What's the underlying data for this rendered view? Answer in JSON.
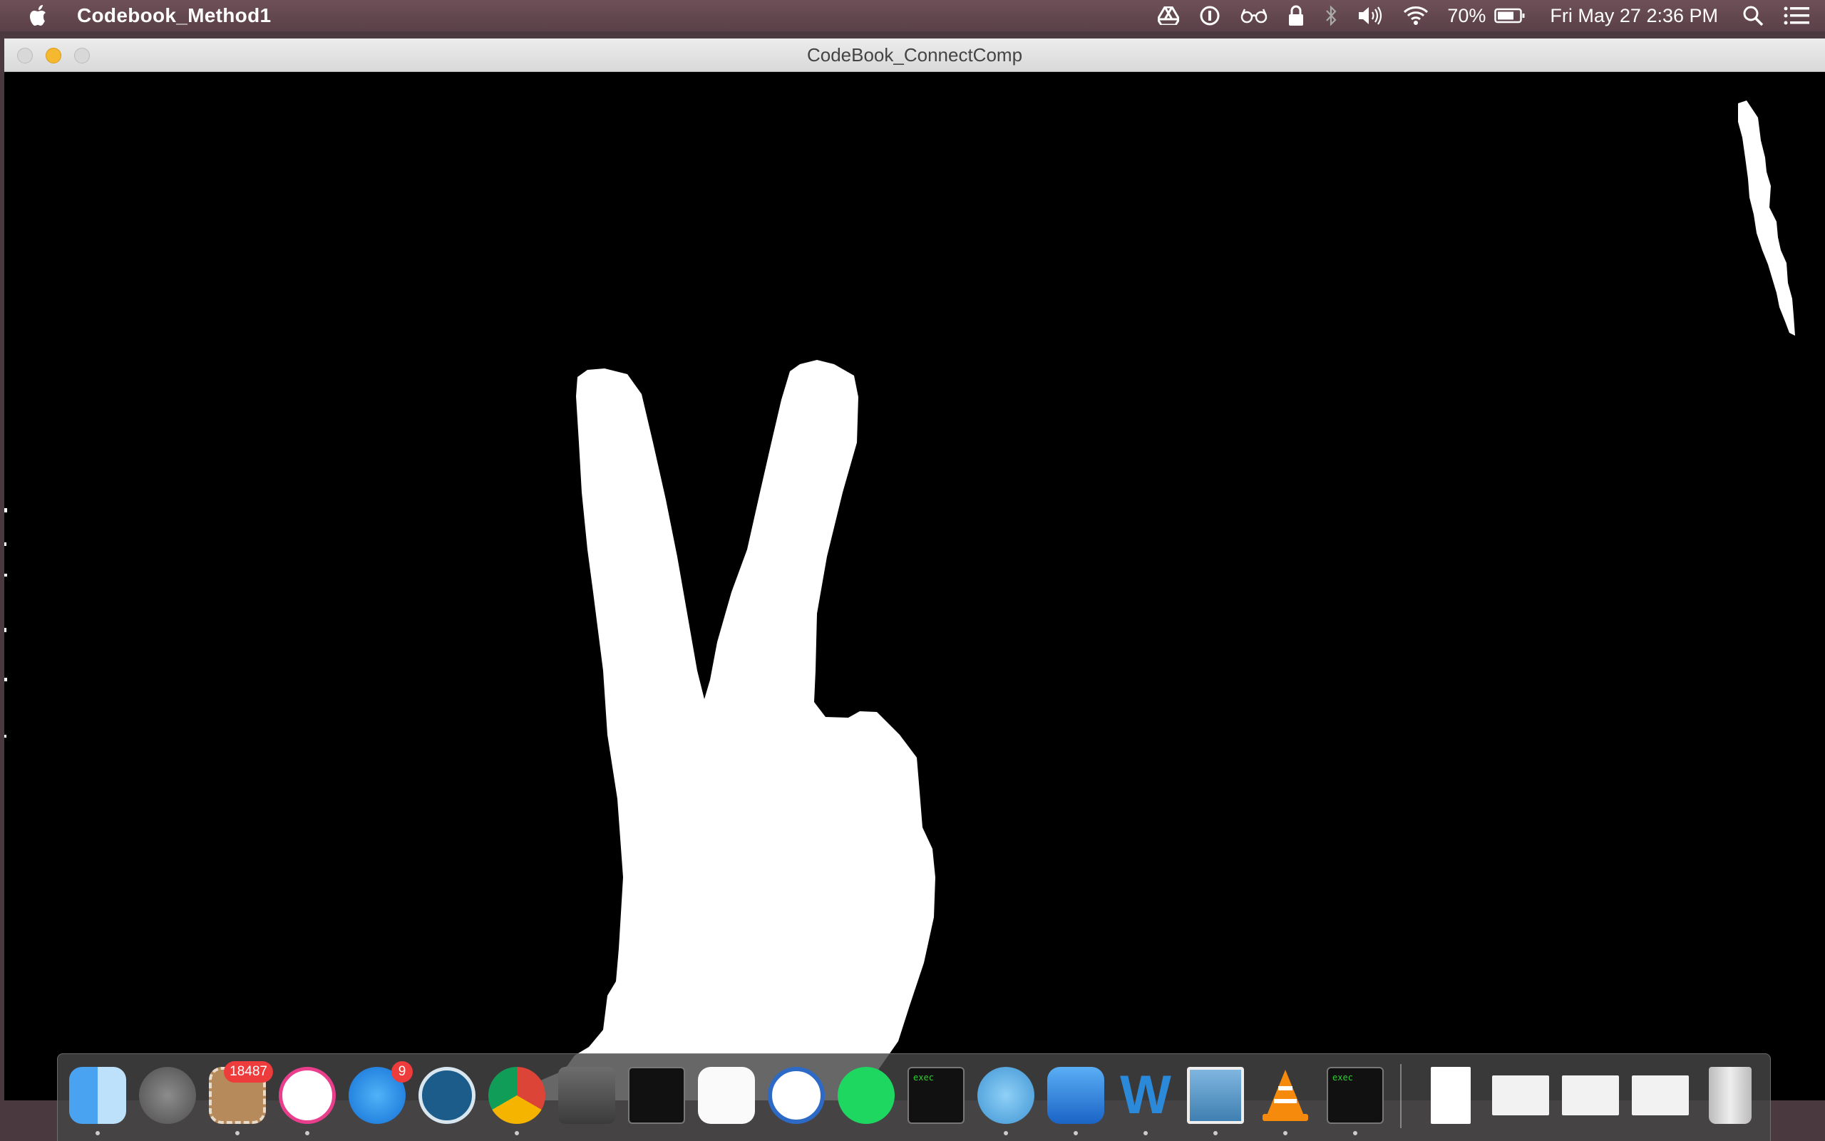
{
  "menubar": {
    "app_name": "Codebook_Method1",
    "battery": "70%",
    "datetime": "Fri May 27  2:36 PM",
    "icons": [
      "google-drive-icon",
      "1password-icon",
      "glasses-icon",
      "lock-icon",
      "bluetooth-icon",
      "volume-icon",
      "wifi-icon",
      "battery-icon",
      "spotlight-icon",
      "notification-center-icon"
    ]
  },
  "window": {
    "title": "CodeBook_ConnectComp"
  },
  "dock": {
    "items": [
      {
        "name": "finder",
        "running": true
      },
      {
        "name": "launchpad",
        "running": false
      },
      {
        "name": "mail",
        "badge": "18487",
        "running": true
      },
      {
        "name": "itunes",
        "running": true
      },
      {
        "name": "app-store",
        "badge": "9",
        "running": false
      },
      {
        "name": "sequel-pro",
        "running": false
      },
      {
        "name": "chrome",
        "running": true
      },
      {
        "name": "sublime-text",
        "running": false
      },
      {
        "name": "terminal",
        "running": false
      },
      {
        "name": "grid-app",
        "running": false
      },
      {
        "name": "1password",
        "running": false
      },
      {
        "name": "spotify",
        "running": false
      },
      {
        "name": "exec-terminal-1",
        "label": "exec",
        "running": false
      },
      {
        "name": "mustache-app",
        "running": true
      },
      {
        "name": "xcode",
        "running": true
      },
      {
        "name": "word",
        "running": true
      },
      {
        "name": "preview",
        "running": true
      },
      {
        "name": "vlc",
        "running": true
      },
      {
        "name": "exec-terminal-2",
        "label": "exec",
        "running": true
      },
      {
        "name": "document",
        "running": false
      },
      {
        "name": "screenshot-1",
        "running": false
      },
      {
        "name": "screenshot-2",
        "running": false
      },
      {
        "name": "screenshot-3",
        "running": false
      },
      {
        "name": "trash",
        "running": false
      }
    ]
  }
}
